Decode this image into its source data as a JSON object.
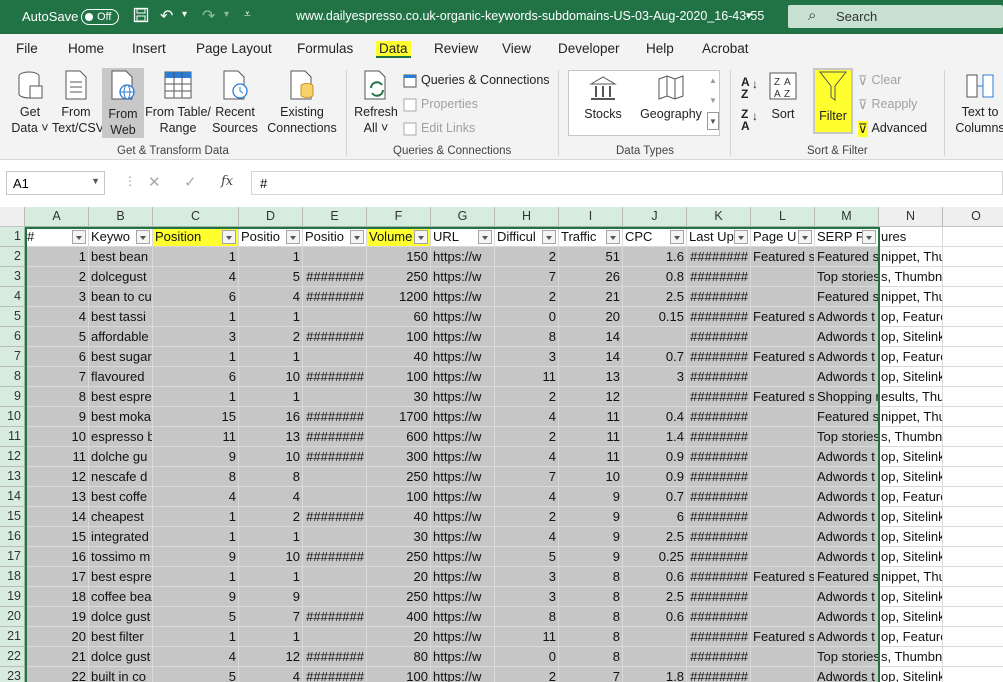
{
  "titlebar": {
    "autosave": "AutoSave",
    "toggle": "Off",
    "filename": "www.dailyespresso.co.uk-organic-keywords-subdomains-US-03-Aug-2020_16-43-55",
    "filename_suffix": "▾",
    "search": "Search",
    "bg": "#217346"
  },
  "tabs": [
    "File",
    "Home",
    "Insert",
    "Page Layout",
    "Formulas",
    "Data",
    "Review",
    "View",
    "Developer",
    "Help",
    "Acrobat"
  ],
  "ribbon": {
    "get_data": [
      "Get",
      "Data ˅"
    ],
    "from_text": [
      "From",
      "Text/CSV"
    ],
    "from_web": [
      "From",
      "Web"
    ],
    "from_table": [
      "From Table/",
      "Range"
    ],
    "recent": [
      "Recent",
      "Sources"
    ],
    "existing": [
      "Existing",
      "Connections"
    ],
    "group_get": "Get & Transform Data",
    "refresh": [
      "Refresh",
      "All ˅"
    ],
    "queries": "Queries & Connections",
    "properties": "Properties",
    "edit_links": "Edit Links",
    "group_queries": "Queries & Connections",
    "stocks": "Stocks",
    "geography": "Geography",
    "group_types": "Data Types",
    "sort": "Sort",
    "filter": "Filter",
    "clear": "Clear",
    "reapply": "Reapply",
    "advanced": "Advanced",
    "group_sort": "Sort & Filter",
    "text_to_cols": [
      "Text to",
      "Columns"
    ]
  },
  "formula": {
    "namebox": "A1",
    "fx": "fx",
    "content": "#"
  },
  "columns": [
    "A",
    "B",
    "C",
    "D",
    "E",
    "F",
    "G",
    "H",
    "I",
    "J",
    "K",
    "L",
    "M",
    "N",
    "O"
  ],
  "headers": [
    "#",
    "Keywo",
    "Position",
    "Positio",
    "Positio",
    "Volume",
    "URL",
    "Difficul",
    "Traffic",
    "CPC",
    "Last Up",
    "Page U",
    "SERP Fe",
    "ures",
    ""
  ],
  "rows": [
    [
      "1",
      "best bean",
      "1",
      "1",
      "",
      "150",
      "https://w",
      "2",
      "51",
      "1.6",
      "########",
      "Featured s",
      "Featured s",
      "nippet, Thumbnail, ",
      ""
    ],
    [
      "2",
      "dolcegust",
      "4",
      "5",
      "########",
      "250",
      "https://w",
      "7",
      "26",
      "0.8",
      "########",
      "",
      "Top stories",
      "s, Thumbnail, Siteli",
      ""
    ],
    [
      "3",
      "bean to cu",
      "6",
      "4",
      "########",
      "1200",
      "https://w",
      "2",
      "21",
      "2.5",
      "########",
      "",
      "Featured s",
      "nippet, Thumbnail, ",
      ""
    ],
    [
      "4",
      "best tassi",
      "1",
      "1",
      "",
      "60",
      "https://w",
      "0",
      "20",
      "0.15",
      "########",
      "Featured s",
      "Adwords t",
      "op, Featured snippe",
      ""
    ],
    [
      "5",
      "affordable",
      "3",
      "2",
      "########",
      "100",
      "https://w",
      "8",
      "14",
      "",
      "########",
      "",
      "Adwords t",
      "op, Sitelinks, People",
      ""
    ],
    [
      "6",
      "best sugar",
      "1",
      "1",
      "",
      "40",
      "https://w",
      "3",
      "14",
      "0.7",
      "########",
      "Featured s",
      "Adwords t",
      "op, Featured snippe",
      ""
    ],
    [
      "7",
      "flavoured",
      "6",
      "10",
      "########",
      "100",
      "https://w",
      "11",
      "13",
      "3",
      "########",
      "",
      "Adwords t",
      "op, Sitelinks, People",
      ""
    ],
    [
      "8",
      "best espre",
      "1",
      "1",
      "",
      "30",
      "https://w",
      "2",
      "12",
      "",
      "########",
      "Featured s",
      "Shopping r",
      "esults, Thumbnail, ",
      ""
    ],
    [
      "9",
      "best moka",
      "15",
      "16",
      "########",
      "1700",
      "https://w",
      "4",
      "11",
      "0.4",
      "########",
      "",
      "Featured s",
      "nippet, Thumbnail, ",
      ""
    ],
    [
      "10",
      "espresso b",
      "11",
      "13",
      "########",
      "600",
      "https://w",
      "2",
      "11",
      "1.4",
      "########",
      "",
      "Top stories",
      "s, Thumbnail, Peopl",
      ""
    ],
    [
      "11",
      "dolche gu",
      "9",
      "10",
      "########",
      "300",
      "https://w",
      "4",
      "11",
      "0.9",
      "########",
      "",
      "Adwords t",
      "op, Sitelinks, People",
      ""
    ],
    [
      "12",
      "nescafe d",
      "8",
      "8",
      "",
      "250",
      "https://w",
      "7",
      "10",
      "0.9",
      "########",
      "",
      "Adwords t",
      "op, Sitelinks, Top st",
      ""
    ],
    [
      "13",
      "best coffe",
      "4",
      "4",
      "",
      "100",
      "https://w",
      "4",
      "9",
      "0.7",
      "########",
      "",
      "Adwords t",
      "op, Featured snippe",
      ""
    ],
    [
      "14",
      "cheapest",
      "1",
      "2",
      "########",
      "40",
      "https://w",
      "2",
      "9",
      "6",
      "########",
      "",
      "Adwords t",
      "op, Sitelinks, People",
      ""
    ],
    [
      "15",
      "integrated",
      "1",
      "1",
      "",
      "30",
      "https://w",
      "4",
      "9",
      "2.5",
      "########",
      "",
      "Adwords t",
      "op, Sitelinks, Top st",
      ""
    ],
    [
      "16",
      "tossimo m",
      "9",
      "10",
      "########",
      "250",
      "https://w",
      "5",
      "9",
      "0.25",
      "########",
      "",
      "Adwords t",
      "op, Sitelinks, People",
      ""
    ],
    [
      "17",
      "best espre",
      "1",
      "1",
      "",
      "20",
      "https://w",
      "3",
      "8",
      "0.6",
      "########",
      "Featured s",
      "Featured s",
      "nippet, Thumbnail, ",
      ""
    ],
    [
      "18",
      "coffee bea",
      "9",
      "9",
      "",
      "250",
      "https://w",
      "3",
      "8",
      "2.5",
      "########",
      "",
      "Adwords t",
      "op, Sitelinks, People",
      ""
    ],
    [
      "19",
      "dolce gust",
      "5",
      "7",
      "########",
      "400",
      "https://w",
      "8",
      "8",
      "0.6",
      "########",
      "",
      "Adwords t",
      "op, Sitelinks, Top st",
      ""
    ],
    [
      "20",
      "best filter",
      "1",
      "1",
      "",
      "20",
      "https://w",
      "11",
      "8",
      "",
      "########",
      "Featured s",
      "Adwords t",
      "op, Featured snippe",
      ""
    ],
    [
      "21",
      "dolce gust",
      "4",
      "12",
      "########",
      "80",
      "https://w",
      "0",
      "8",
      "",
      "########",
      "",
      "Top stories",
      "s, Thumbnail, Peopl",
      ""
    ],
    [
      "22",
      "built in co",
      "5",
      "4",
      "########",
      "100",
      "https://w",
      "2",
      "7",
      "1.8",
      "########",
      "",
      "Adwords t",
      "op, Sitelinks, People",
      ""
    ]
  ],
  "colors": {
    "accent": "#217346",
    "highlight": "#ffff30",
    "selection": "#c6c6c6"
  }
}
